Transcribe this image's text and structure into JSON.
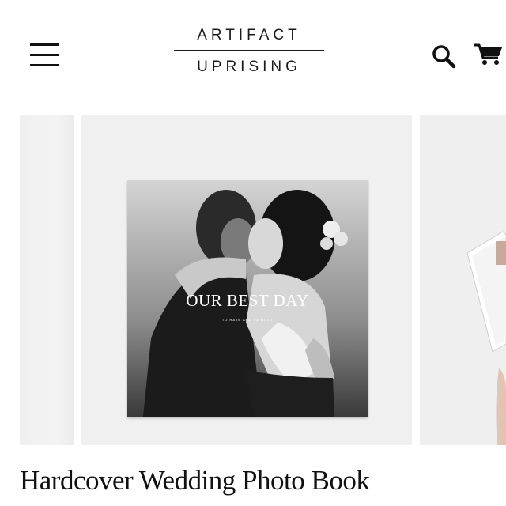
{
  "header": {
    "menu_icon": "hamburger-menu-icon",
    "logo": {
      "line1": "ARTIFACT",
      "line2": "UPRISING"
    },
    "search_icon": "search-icon",
    "cart_icon": "cart-icon"
  },
  "carousel": {
    "book_cover": {
      "title": "OUR BEST DAY",
      "subtitle": "TO HAVE AND TO HOLD"
    }
  },
  "product": {
    "title": "Hardcover Wedding Photo Book"
  },
  "colors": {
    "text": "#111111",
    "slide_bg": "#f0f0f0"
  }
}
